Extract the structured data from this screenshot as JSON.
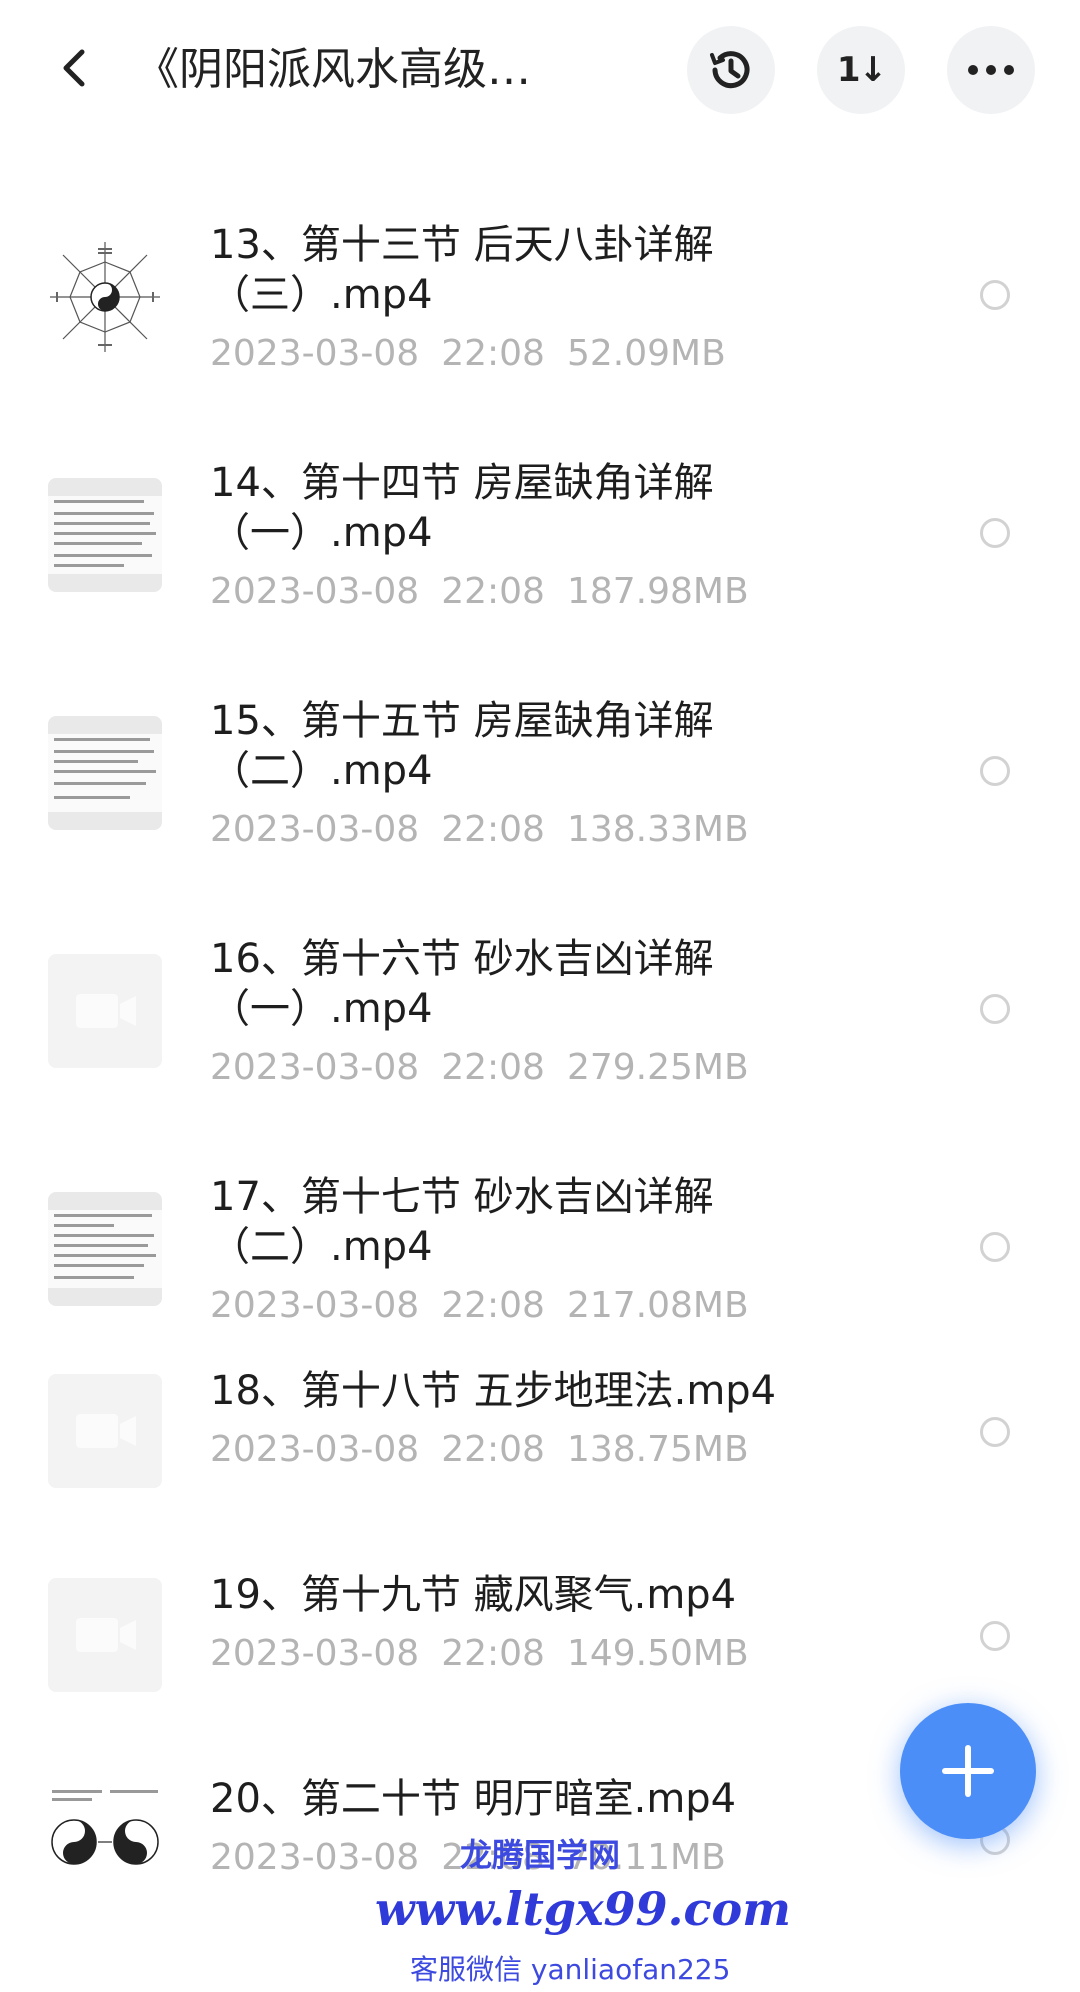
{
  "header": {
    "title": "《阴阳派风水高级…",
    "icons": {
      "back": "back-arrow-icon",
      "history": "history-icon",
      "sort": "sort-icon",
      "more": "more-icon"
    },
    "sort_label": "1↓"
  },
  "files": [
    {
      "name": "13、第十三节  后天八卦详解（三）.mp4",
      "date": "2023-03-08",
      "time": "22:08",
      "size": "52.09MB",
      "thumb": "bagua"
    },
    {
      "name": "14、第十四节  房屋缺角详解（一）.mp4",
      "date": "2023-03-08",
      "time": "22:08",
      "size": "187.98MB",
      "thumb": "doc"
    },
    {
      "name": "15、第十五节  房屋缺角详解（二）.mp4",
      "date": "2023-03-08",
      "time": "22:08",
      "size": "138.33MB",
      "thumb": "doc"
    },
    {
      "name": "16、第十六节 砂水吉凶详解（一）.mp4",
      "date": "2023-03-08",
      "time": "22:08",
      "size": "279.25MB",
      "thumb": "video"
    },
    {
      "name": "17、第十七节  砂水吉凶详解（二）.mp4",
      "date": "2023-03-08",
      "time": "22:08",
      "size": "217.08MB",
      "thumb": "doc"
    },
    {
      "name": "18、第十八节  五步地理法.mp4",
      "date": "2023-03-08",
      "time": "22:08",
      "size": "138.75MB",
      "thumb": "video"
    },
    {
      "name": "19、第十九节  藏风聚气.mp4",
      "date": "2023-03-08",
      "time": "22:08",
      "size": "149.50MB",
      "thumb": "video"
    },
    {
      "name": "20、第二十节  明厅暗室.mp4",
      "date": "2023-03-08",
      "time": "22:08",
      "size": "70.11MB",
      "thumb": "taiji"
    }
  ],
  "fab": {
    "icon": "plus-icon",
    "color": "#4c8ef7"
  },
  "watermark": {
    "site_name": "龙腾国学网",
    "url": "www.ltgx99.com",
    "contact": "客服微信 yanliaofan225"
  }
}
